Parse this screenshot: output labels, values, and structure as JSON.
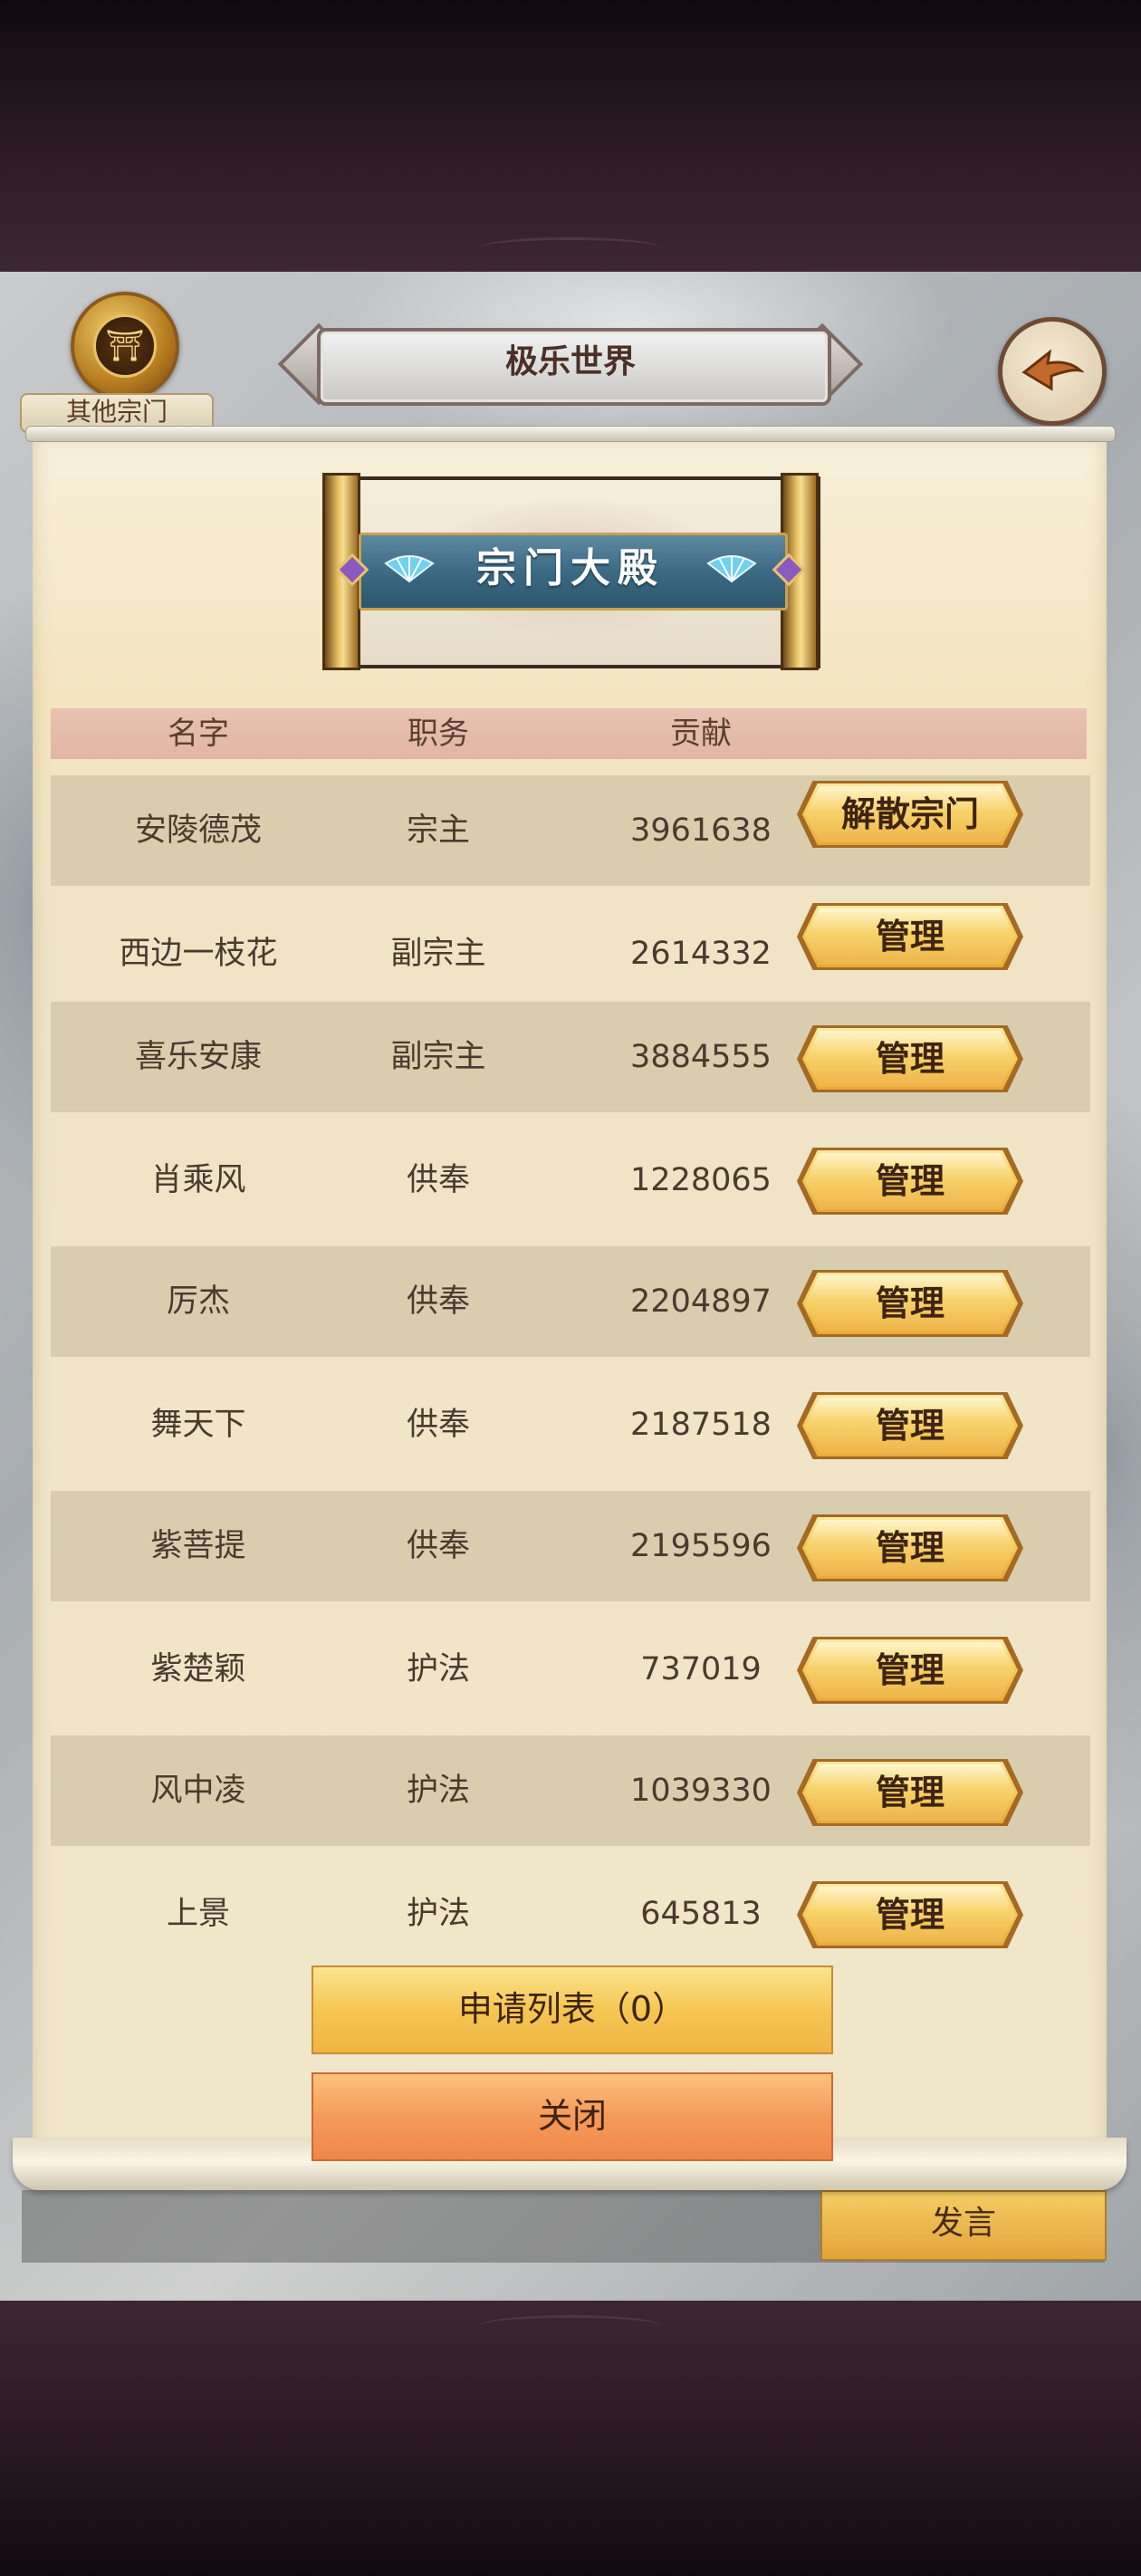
{
  "header": {
    "world_title": "极乐世界",
    "other_sect_label": "其他宗门"
  },
  "panel": {
    "title": "宗门大殿",
    "columns": [
      "名字",
      "职务",
      "贡献"
    ],
    "members": [
      {
        "name": "安陵德茂",
        "role": "宗主",
        "contribution": "3961638",
        "action": "解散宗门"
      },
      {
        "name": "西边一枝花",
        "role": "副宗主",
        "contribution": "2614332",
        "action": "管理"
      },
      {
        "name": "喜乐安康",
        "role": "副宗主",
        "contribution": "3884555",
        "action": "管理"
      },
      {
        "name": "肖乘风",
        "role": "供奉",
        "contribution": "1228065",
        "action": "管理"
      },
      {
        "name": "厉杰",
        "role": "供奉",
        "contribution": "2204897",
        "action": "管理"
      },
      {
        "name": "舞天下",
        "role": "供奉",
        "contribution": "2187518",
        "action": "管理"
      },
      {
        "name": "紫菩提",
        "role": "供奉",
        "contribution": "2195596",
        "action": "管理"
      },
      {
        "name": "紫楚颖",
        "role": "护法",
        "contribution": "737019",
        "action": "管理"
      },
      {
        "name": "风中凌",
        "role": "护法",
        "contribution": "1039330",
        "action": "管理"
      },
      {
        "name": "上景",
        "role": "护法",
        "contribution": "645813",
        "action": "管理"
      }
    ],
    "apply_list_label": "申请列表（0）",
    "close_label": "关闭"
  },
  "footer": {
    "speak_label": "发言"
  },
  "icons": {
    "back": "back-arrow-icon",
    "emblem": "sect-emblem-icon",
    "fan": "fan-icon"
  },
  "colors": {
    "action_gold": "#f5c956",
    "close_orange": "#f59a5a",
    "header_row": "#e4b9a9",
    "ribbon_blue": "#3d6a84"
  }
}
